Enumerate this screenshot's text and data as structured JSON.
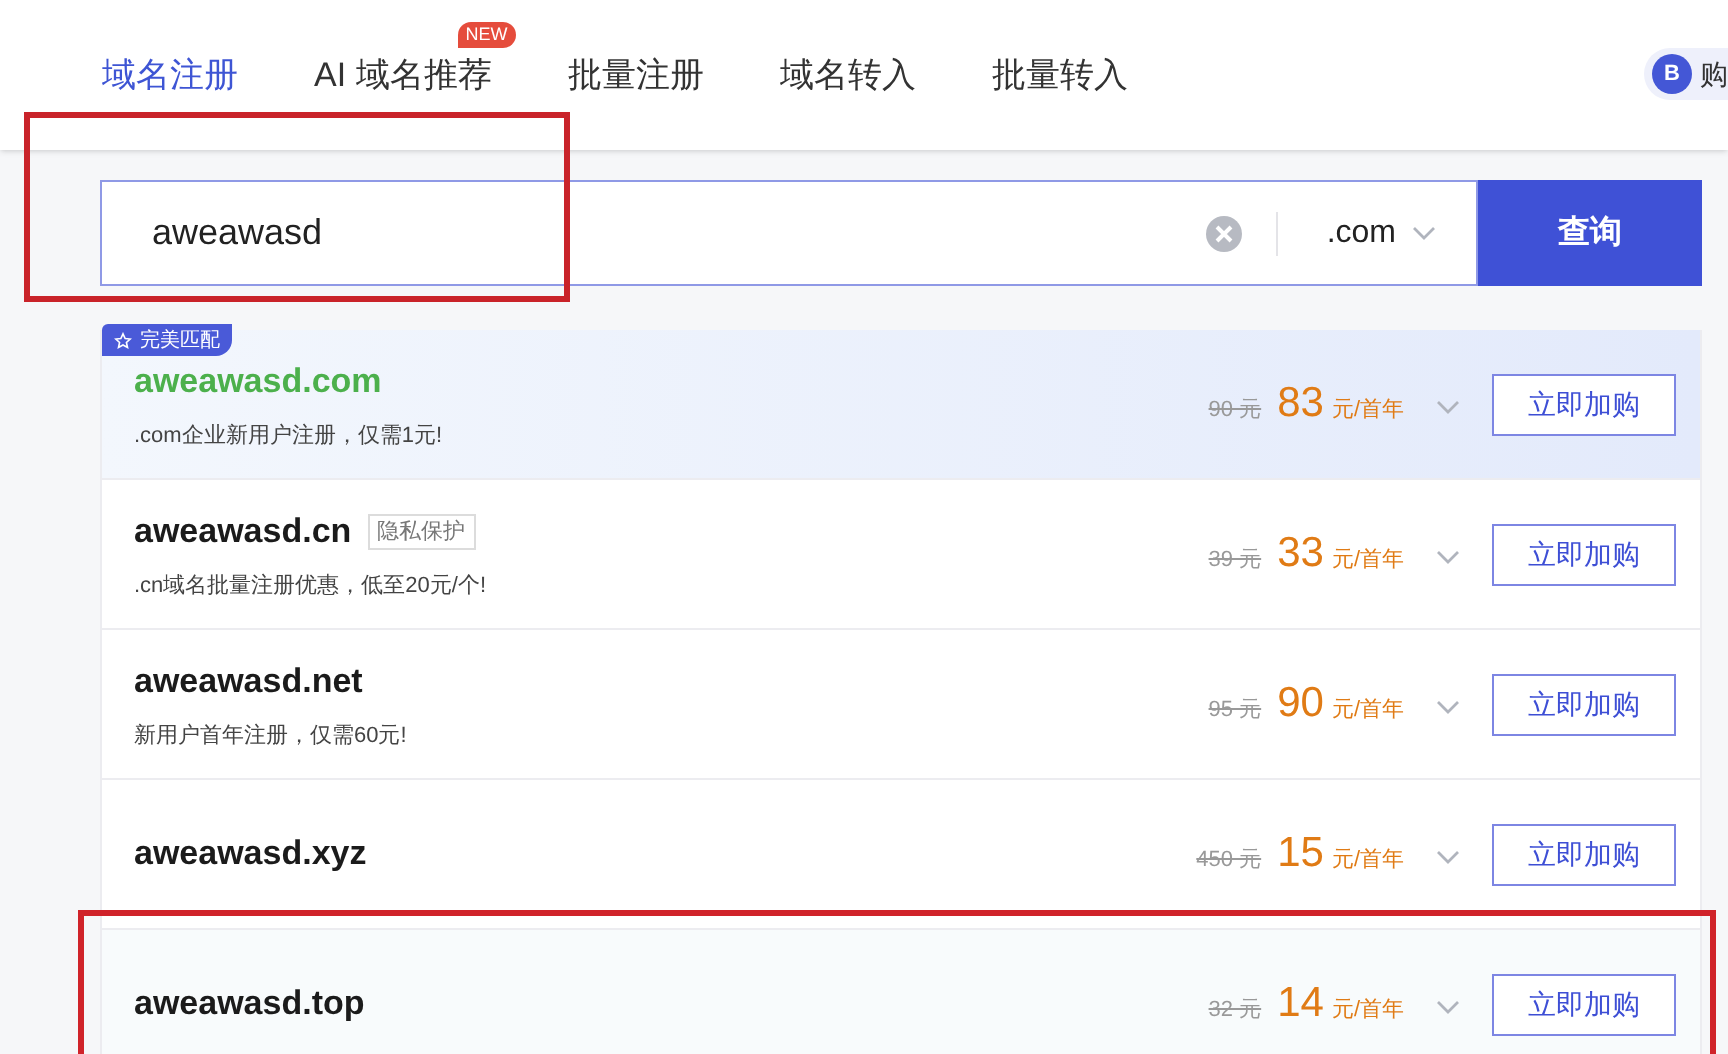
{
  "tabs": [
    {
      "label": "域名注册",
      "selected": true
    },
    {
      "label": "AI 域名推荐",
      "selected": false,
      "badge": "NEW"
    },
    {
      "label": "批量注册",
      "selected": false
    },
    {
      "label": "域名转入",
      "selected": false
    },
    {
      "label": "批量转入",
      "selected": false
    }
  ],
  "cart": {
    "icon_letter": "B",
    "label": "购"
  },
  "search": {
    "value": "aweawasd",
    "suffix": ".com",
    "button": "查询",
    "annotated": true
  },
  "results": [
    {
      "name": "aweawasd",
      "tld": ".com",
      "match_badge": "完美匹配",
      "note": ".com企业新用户注册，仅需1元!",
      "old_price": "90",
      "old_unit": "元",
      "price": "83",
      "unit": "元/首年",
      "button": "立即加购",
      "annotated": false
    },
    {
      "name": "aweawasd",
      "tld": ".cn",
      "tag": "隐私保护",
      "note": ".cn域名批量注册优惠，低至20元/个!",
      "old_price": "39",
      "old_unit": "元",
      "price": "33",
      "unit": "元/首年",
      "button": "立即加购",
      "annotated": false
    },
    {
      "name": "aweawasd",
      "tld": ".net",
      "note": "新用户首年注册，仅需60元!",
      "old_price": "95",
      "old_unit": "元",
      "price": "90",
      "unit": "元/首年",
      "button": "立即加购",
      "annotated": false
    },
    {
      "name": "aweawasd",
      "tld": ".xyz",
      "old_price": "450",
      "old_unit": "元",
      "price": "15",
      "unit": "元/首年",
      "button": "立即加购",
      "annotated": false
    },
    {
      "name": "aweawasd",
      "tld": ".top",
      "old_price": "32",
      "old_unit": "元",
      "price": "14",
      "unit": "元/首年",
      "button": "立即加购",
      "annotated": true
    }
  ]
}
